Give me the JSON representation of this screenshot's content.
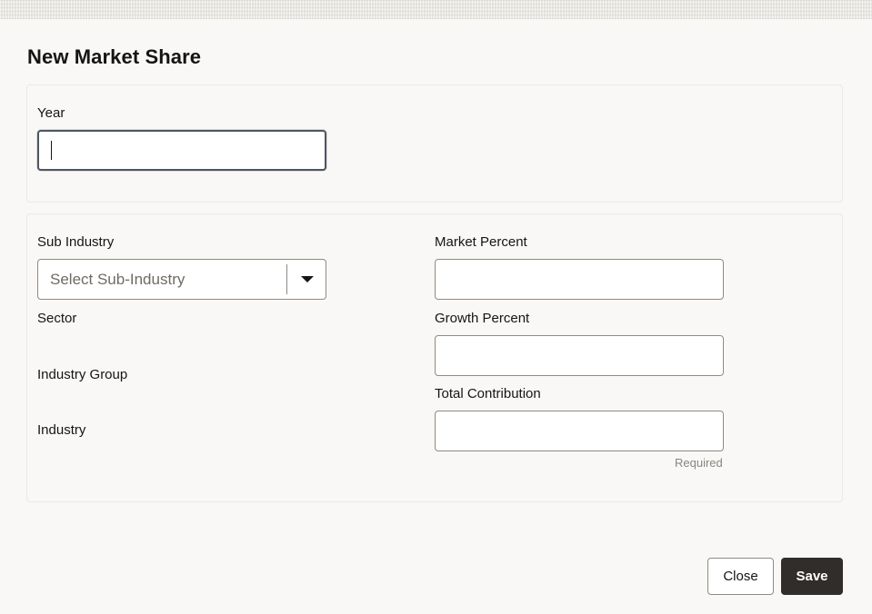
{
  "dialog": {
    "title": "New Market Share"
  },
  "year_section": {
    "year_label": "Year",
    "year_value": ""
  },
  "details": {
    "sub_industry_label": "Sub Industry",
    "sub_industry_placeholder": "Select Sub-Industry",
    "sector_label": "Sector",
    "industry_group_label": "Industry Group",
    "industry_label": "Industry",
    "market_percent_label": "Market Percent",
    "market_percent_value": "",
    "growth_percent_label": "Growth Percent",
    "growth_percent_value": "",
    "total_contribution_label": "Total Contribution",
    "total_contribution_value": "",
    "total_contribution_helper": "Required"
  },
  "footer": {
    "close_label": "Close",
    "save_label": "Save"
  },
  "icons": {
    "dropdown": "chevron-down-icon"
  },
  "colors": {
    "background": "#f9f8f6",
    "primary_button": "#312d2a",
    "text": "#161513",
    "focus_border": "#4e5662"
  }
}
